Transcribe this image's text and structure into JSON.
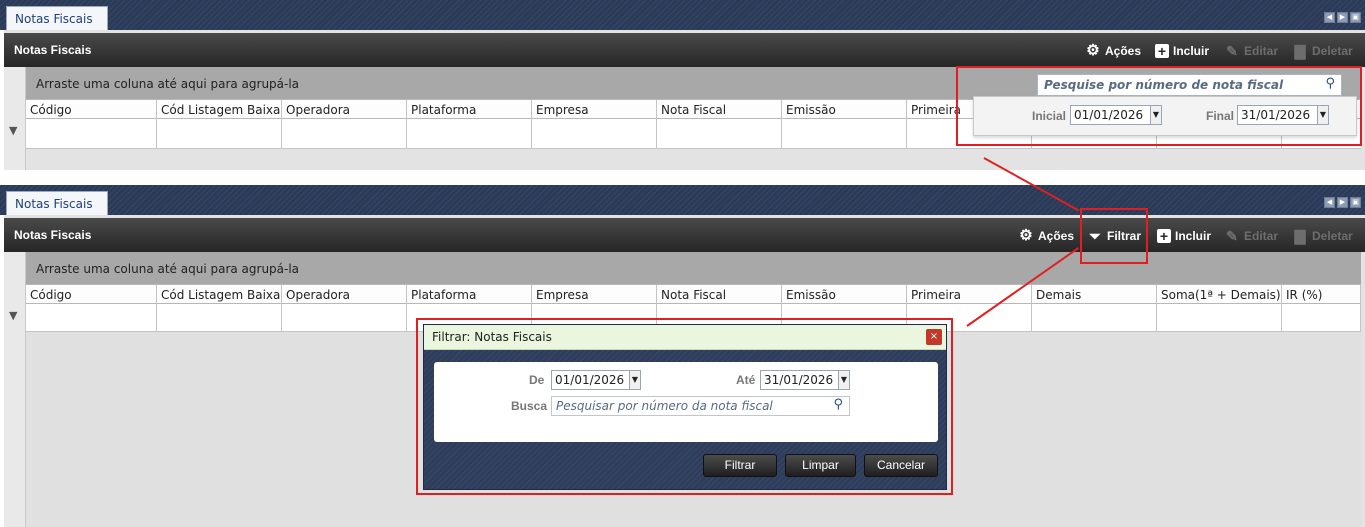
{
  "tab_title": "Notas Fiscais",
  "toolbar": {
    "title": "Notas Fiscais",
    "actions_label": "Ações",
    "filter_label": "Filtrar",
    "add_label": "Incluir",
    "edit_label": "Editar",
    "delete_label": "Deletar"
  },
  "group_bar_text": "Arraste uma coluna até aqui para agrupá-la",
  "columns": [
    "Código",
    "Cód Listagem Baixa",
    "Operadora",
    "Plataforma",
    "Empresa",
    "Nota Fiscal",
    "Emissão",
    "Primeira",
    "Demais",
    "Soma(1ª + Demais)",
    "IR (%)"
  ],
  "panel1_filter": {
    "search_placeholder": "Pesquise por número de nota fiscal",
    "initial_label": "Inicial",
    "initial_value": "01/01/2026",
    "final_label": "Final",
    "final_value": "31/01/2026"
  },
  "dialog": {
    "title": "Filtrar: Notas Fiscais",
    "from_label": "De",
    "from_value": "01/01/2026",
    "to_label": "Até",
    "to_value": "31/01/2026",
    "search_label": "Busca",
    "search_placeholder": "Pesquisar por número da nota fiscal",
    "filter_button": "Filtrar",
    "clear_button": "Limpar",
    "cancel_button": "Cancelar"
  },
  "colors": {
    "highlight": "#e02020",
    "titlebar": "#2b2b2b",
    "tabstrip": "#2a3a58"
  },
  "icons": [
    "gear-icon",
    "funnel-icon",
    "plus-icon",
    "edit-icon",
    "trash-icon",
    "search-icon",
    "close-icon",
    "chevron-down-icon"
  ]
}
